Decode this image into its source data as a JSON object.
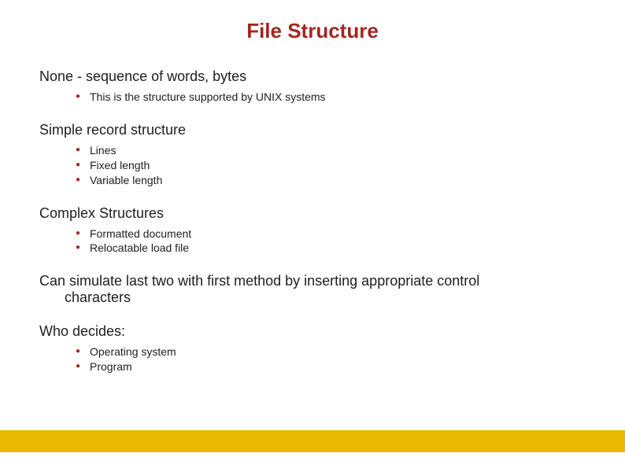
{
  "title": "File Structure",
  "sections": [
    {
      "heading": "None - sequence of words, bytes",
      "bullets": [
        "This is the structure supported  by UNIX systems"
      ]
    },
    {
      "heading": "Simple record structure",
      "bullets": [
        "Lines",
        "Fixed length",
        "Variable length"
      ]
    },
    {
      "heading": "Complex Structures",
      "bullets": [
        "Formatted document",
        "Relocatable load file"
      ]
    }
  ],
  "body1_line1": "Can simulate last two with first method by inserting appropriate control",
  "body1_line2": "characters",
  "section5": {
    "heading": "Who decides:",
    "bullets": [
      "Operating system",
      "Program"
    ]
  }
}
